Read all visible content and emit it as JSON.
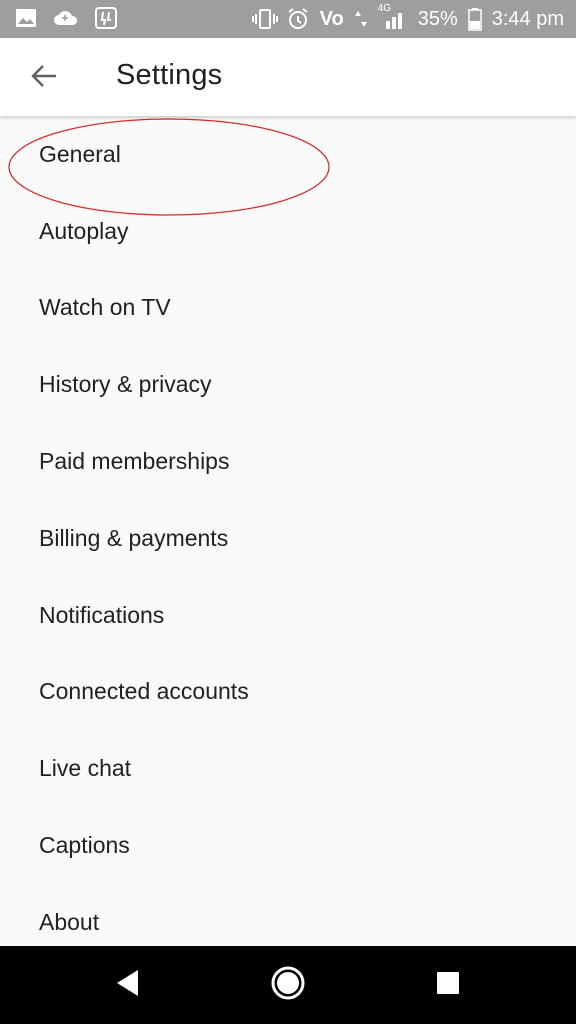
{
  "status_bar": {
    "battery_percent": "35%",
    "time": "3:44 pm",
    "network_label": "Vo",
    "network_type": "4G",
    "icons": [
      "image-icon",
      "cloud-icon",
      "app-icon",
      "vibrate-icon",
      "alarm-icon",
      "volte-icon",
      "data-arrows-icon",
      "signal-icon",
      "battery-icon"
    ]
  },
  "app_bar": {
    "title": "Settings",
    "back_icon": "arrow-back-icon"
  },
  "settings": {
    "items": [
      {
        "label": "General"
      },
      {
        "label": "Autoplay"
      },
      {
        "label": "Watch on TV"
      },
      {
        "label": "History & privacy"
      },
      {
        "label": "Paid memberships"
      },
      {
        "label": "Billing & payments"
      },
      {
        "label": "Notifications"
      },
      {
        "label": "Connected accounts"
      },
      {
        "label": "Live chat"
      },
      {
        "label": "Captions"
      },
      {
        "label": "About"
      }
    ]
  },
  "annotation": {
    "shape": "ellipse",
    "color": "#d32f2f",
    "target": "General"
  },
  "nav_bar": {
    "buttons": [
      "back-triangle-icon",
      "home-circle-icon",
      "recents-square-icon"
    ]
  },
  "colors": {
    "status_bar_bg": "#9e9e9e",
    "app_bar_bg": "#ffffff",
    "list_bg": "#fafafa",
    "text": "#212121",
    "nav_bar_bg": "#000000"
  }
}
